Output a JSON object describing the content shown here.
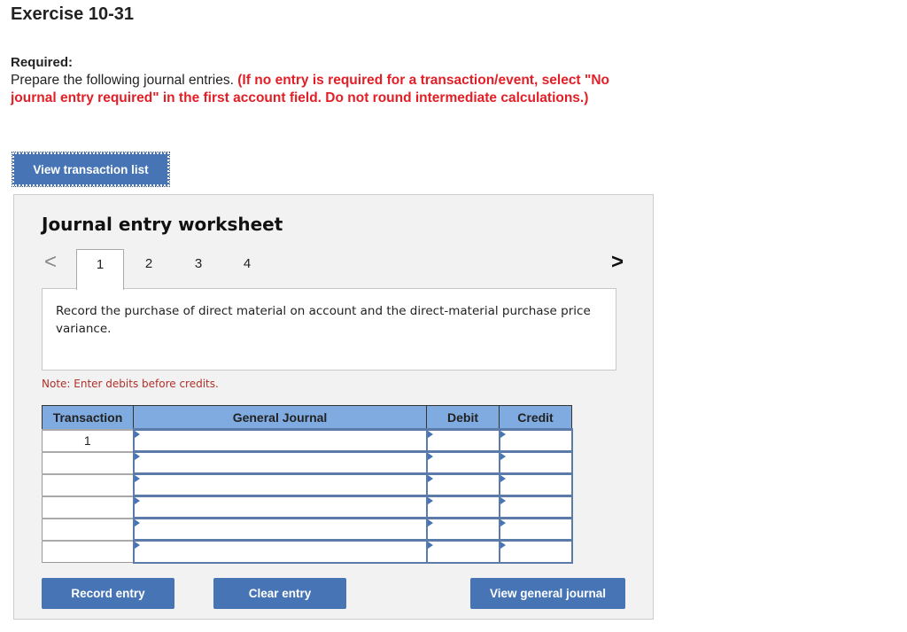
{
  "exercise": {
    "title": "Exercise 10-31",
    "required_label": "Required:",
    "instruction_plain": "Prepare the following journal entries. ",
    "instruction_red": "(If no entry is required for a transaction/event, select \"No journal entry required\" in the first account field. Do not round intermediate calculations.)"
  },
  "buttons": {
    "view_transaction_list": "View transaction list",
    "record_entry": "Record entry",
    "clear_entry": "Clear entry",
    "view_general_journal": "View general journal"
  },
  "worksheet": {
    "title": "Journal entry worksheet",
    "prev_icon": "chevron-left-icon",
    "next_icon": "chevron-right-icon",
    "prev_glyph": "<",
    "next_glyph": ">",
    "tabs": [
      {
        "label": "1",
        "active": true
      },
      {
        "label": "2",
        "active": false
      },
      {
        "label": "3",
        "active": false
      },
      {
        "label": "4",
        "active": false
      }
    ],
    "description": "Record the purchase of direct material on account and the direct-material purchase price variance.",
    "note": "Note: Enter debits before credits."
  },
  "journal_table": {
    "headers": [
      "Transaction",
      "General Journal",
      "Debit",
      "Credit"
    ],
    "rows": [
      {
        "transaction": "1",
        "account": "",
        "debit": "",
        "credit": ""
      },
      {
        "transaction": "",
        "account": "",
        "debit": "",
        "credit": ""
      },
      {
        "transaction": "",
        "account": "",
        "debit": "",
        "credit": ""
      },
      {
        "transaction": "",
        "account": "",
        "debit": "",
        "credit": ""
      },
      {
        "transaction": "",
        "account": "",
        "debit": "",
        "credit": ""
      },
      {
        "transaction": "",
        "account": "",
        "debit": "",
        "credit": ""
      }
    ]
  },
  "colors": {
    "button_blue": "#4674b5",
    "header_blue": "#7fabe0",
    "instruction_red": "#e21f26",
    "note_red": "#b0302a",
    "panel_gray": "#f2f2f2"
  }
}
